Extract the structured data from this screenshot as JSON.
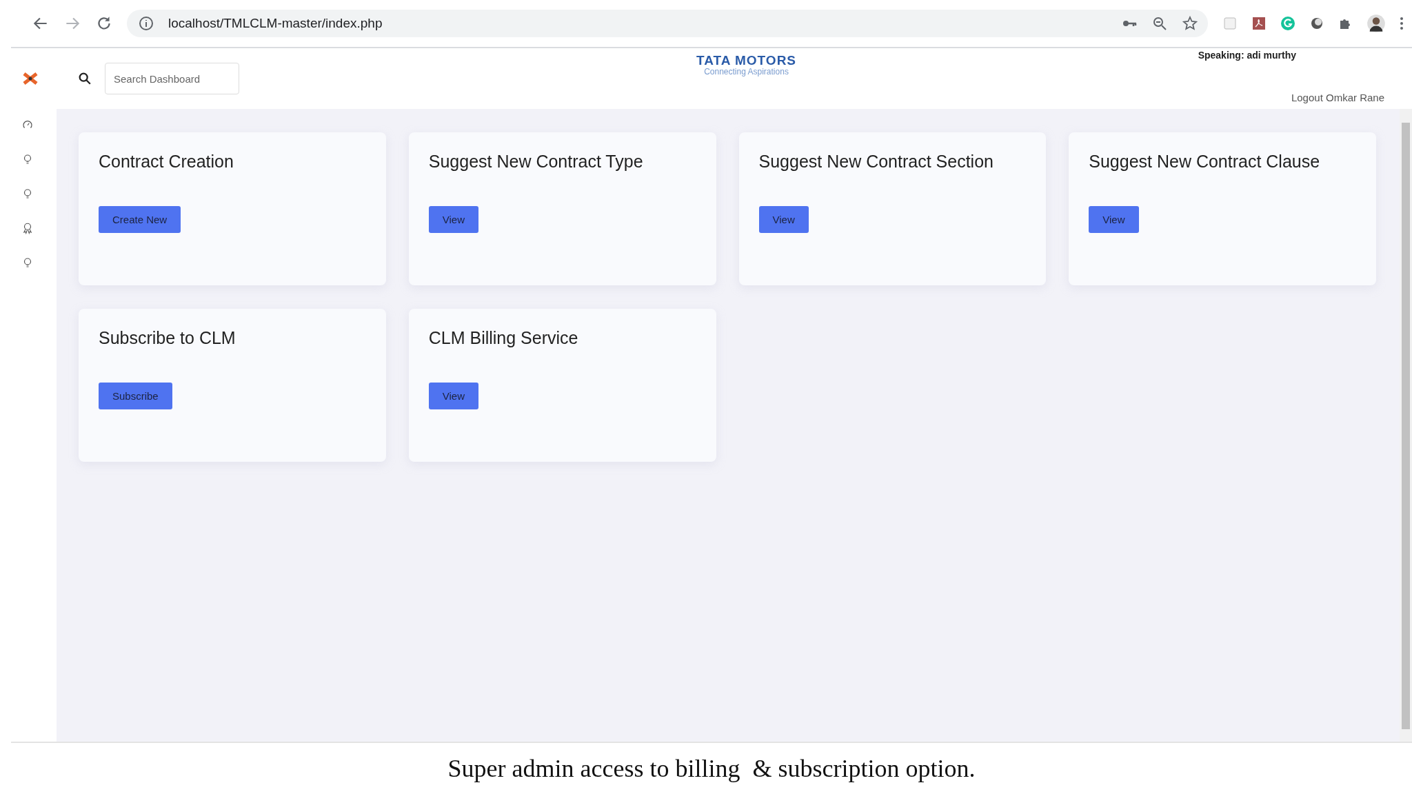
{
  "browser": {
    "url": "localhost/TMLCLM-master/index.php",
    "tooltip": "Speaking: adi murthy"
  },
  "header": {
    "search": {
      "placeholder": "Search Dashboard"
    },
    "logo": {
      "name": "TATA MOTORS",
      "tagline": "Connecting Aspirations"
    },
    "logout": "Logout Omkar Rane"
  },
  "sidebar": {
    "items": [
      {
        "kind": "gauge"
      },
      {
        "kind": "bulb"
      },
      {
        "kind": "bulb"
      },
      {
        "kind": "award"
      },
      {
        "kind": "bulb"
      }
    ]
  },
  "cards": [
    {
      "title": "Contract Creation",
      "button": "Create New"
    },
    {
      "title": "Suggest New Contract Type",
      "button": "View"
    },
    {
      "title": "Suggest New Contract Section",
      "button": "View"
    },
    {
      "title": "Suggest New Contract Clause",
      "button": "View"
    },
    {
      "title": "Subscribe to CLM",
      "button": "Subscribe"
    },
    {
      "title": "CLM Billing Service",
      "button": "View"
    }
  ],
  "caption": "Super admin access to billing  & subscription option."
}
